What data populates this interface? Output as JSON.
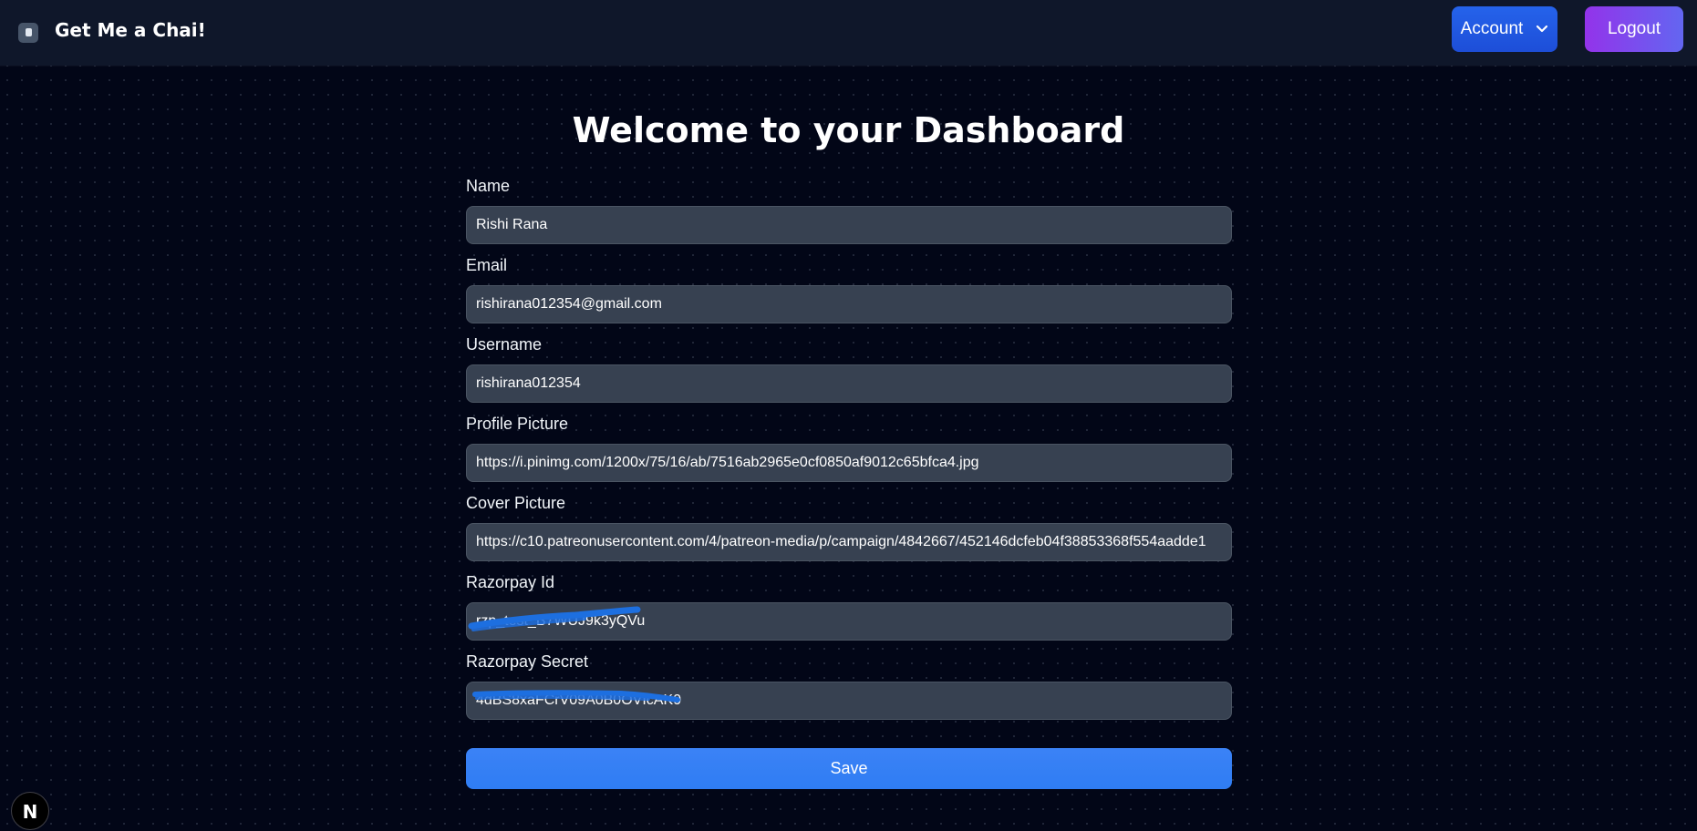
{
  "navbar": {
    "brand_title": "Get Me a Chai!",
    "brand_icon": "logo-icon",
    "account_label": "Account",
    "account_icon": "chevron-down-icon",
    "logout_label": "Logout"
  },
  "main": {
    "title": "Welcome to your Dashboard",
    "fields": {
      "name": {
        "label": "Name",
        "value": "Rishi Rana"
      },
      "email": {
        "label": "Email",
        "value": "rishirana012354@gmail.com"
      },
      "username": {
        "label": "Username",
        "value": "rishirana012354"
      },
      "profile_picture": {
        "label": "Profile Picture",
        "value": "https://i.pinimg.com/1200x/75/16/ab/7516ab2965e0cf0850af9012c65bfca4.jpg"
      },
      "cover_picture": {
        "label": "Cover Picture",
        "value": "https://c10.patreonusercontent.com/4/patreon-media/p/campaign/4842667/452146dcfeb04f38853368f554aadde1"
      },
      "razorpay_id": {
        "label": "Razorpay Id",
        "value": "rzp_test_B7WUJ9k3yQVu"
      },
      "razorpay_secret": {
        "label": "Razorpay Secret",
        "value": "4dBS8xaFCrV09A0B0OVIcAK0"
      }
    },
    "save_label": "Save"
  },
  "dev_badge": {
    "letter": "N"
  },
  "colors": {
    "background": "#020617",
    "navbar": "#0f172a",
    "input_bg": "#374151",
    "account_button": "#1d4ed8",
    "logout_gradient_start": "#9333ea",
    "logout_gradient_end": "#6366f1",
    "save_button": "#2f80f5",
    "redaction_scribble": "#1d6fe0"
  }
}
